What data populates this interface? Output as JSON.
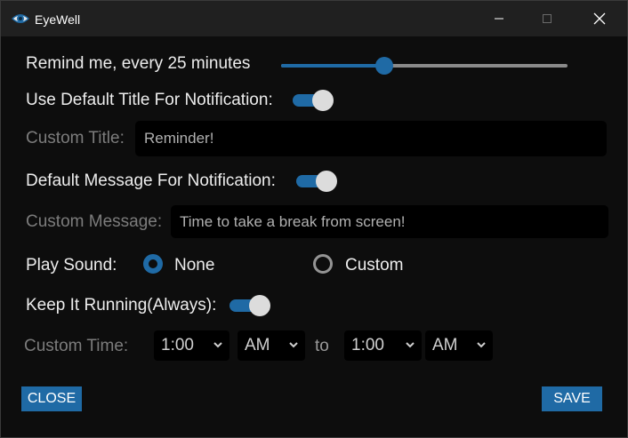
{
  "window": {
    "title": "EyeWell"
  },
  "reminder": {
    "label": "Remind me, every 25 minutes",
    "interval_minutes": 25,
    "slider_fraction": 0.36
  },
  "default_title": {
    "label": "Use Default Title For Notification:",
    "enabled": true
  },
  "custom_title": {
    "label": "Custom Title:",
    "placeholder": "Reminder!"
  },
  "default_message": {
    "label": "Default Message For Notification:",
    "enabled": true
  },
  "custom_message": {
    "label": "Custom Message:",
    "placeholder": "Time to take a break from screen!"
  },
  "play_sound": {
    "label": "Play Sound:",
    "options": [
      "None",
      "Custom"
    ],
    "selected": "None"
  },
  "keep_running": {
    "label": "Keep It Running(Always):",
    "enabled": true
  },
  "custom_time": {
    "label": "Custom Time:",
    "start_hour": "1:00",
    "start_period": "AM",
    "separator": "to",
    "end_hour": "1:00",
    "end_period": "AM"
  },
  "buttons": {
    "close": "CLOSE",
    "save": "SAVE"
  },
  "colors": {
    "accent": "#1f6aa5",
    "background": "#0d0d0d",
    "titlebar": "#202020",
    "text": "#ededed",
    "muted": "#7c7c7c"
  }
}
